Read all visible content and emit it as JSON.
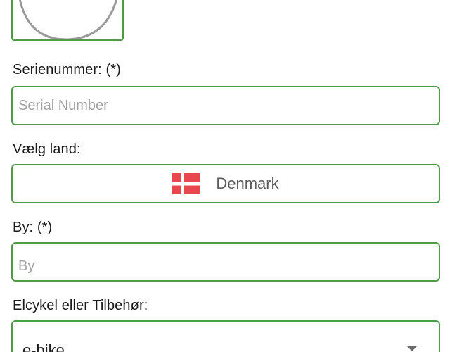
{
  "serial": {
    "label": "Serienummer: (*)",
    "placeholder": "Serial Number",
    "value": ""
  },
  "country": {
    "label": "Vælg land:",
    "selected": "Denmark",
    "flag_icon": "denmark-flag-icon",
    "flag_colors": {
      "red": "#e8474f",
      "white": "#ffffff"
    }
  },
  "city": {
    "label": "By: (*)",
    "placeholder": "By",
    "value": ""
  },
  "product_type": {
    "label": "Elcykel eller Tilbehør:",
    "selected": "e-bike"
  },
  "colors": {
    "border": "#4f9a46",
    "placeholder": "#a3a3a3"
  }
}
